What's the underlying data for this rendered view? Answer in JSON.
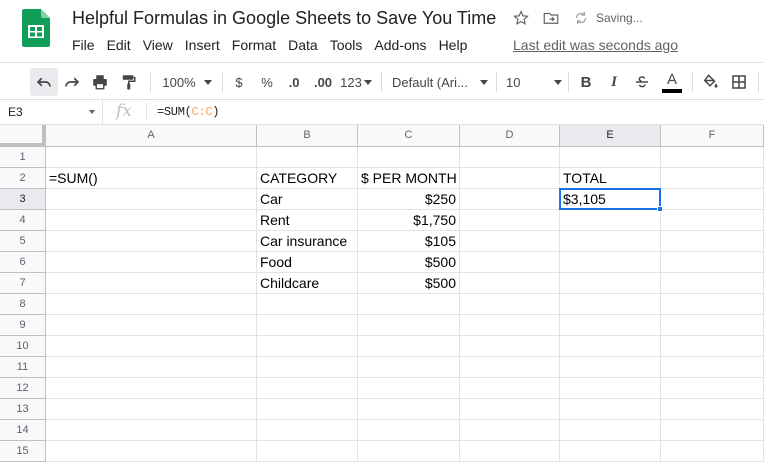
{
  "app": {
    "doc_title": "Helpful Formulas in Google Sheets to Save You Time",
    "saving_status": "Saving...",
    "last_edit": "Last edit was seconds ago",
    "brand_color": "#0f9d58"
  },
  "menu": [
    "File",
    "Edit",
    "View",
    "Insert",
    "Format",
    "Data",
    "Tools",
    "Add-ons",
    "Help"
  ],
  "toolbar": {
    "zoom": "100%",
    "currency": "$",
    "percent": "%",
    "decrease_decimal": ".0",
    "increase_decimal": ".00",
    "more_formats": "123",
    "font": "Default (Ari...",
    "font_size": "10",
    "bold": "B",
    "italic": "I",
    "text_color_letter": "A"
  },
  "formula_bar": {
    "name_box": "E3",
    "fx": "fx",
    "formula_prefix": "=SUM(",
    "formula_ref": "C:C",
    "formula_suffix": ")"
  },
  "grid": {
    "columns": [
      "A",
      "B",
      "C",
      "D",
      "E",
      "F"
    ],
    "active_column": "E",
    "active_row": 3,
    "rows": [
      "1",
      "2",
      "3",
      "4",
      "5",
      "6",
      "7",
      "8",
      "9",
      "10",
      "11",
      "12",
      "13",
      "14",
      "15"
    ],
    "cells": {
      "A2": "=SUM()",
      "B2": "CATEGORY",
      "C2": "$ PER MONTH",
      "E2": "TOTAL",
      "B3": "Car",
      "C3": "$250",
      "E3": "$3,105",
      "B4": "Rent",
      "C4": "$1,750",
      "B5": "Car insurance",
      "C5": "$105",
      "B6": "Food",
      "C6": "$500",
      "B7": "Childcare",
      "C7": "$500"
    }
  }
}
